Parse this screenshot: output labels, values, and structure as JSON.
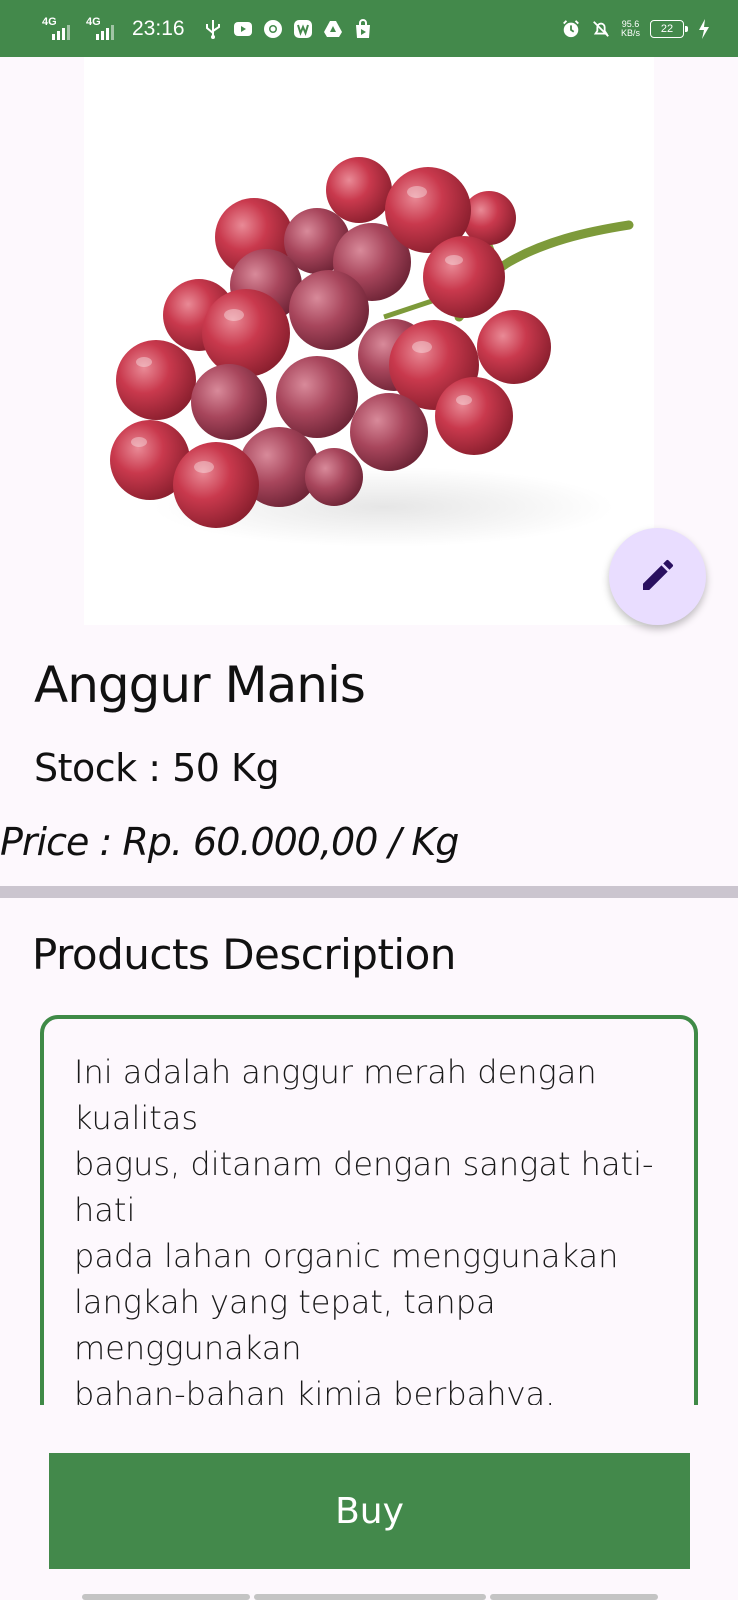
{
  "status_bar": {
    "sig1": "4G",
    "sig2": "4G",
    "time": "23:16",
    "net_speed_value": "95.6",
    "net_speed_unit": "KB/s",
    "battery": "22"
  },
  "product": {
    "name": "Anggur Manis",
    "stock": "Stock : 50 Kg",
    "price": "Price : Rp. 60.000,00 / Kg"
  },
  "description": {
    "heading": "Products Description",
    "text": "Ini adalah anggur merah dengan kualitas\nbagus, ditanam dengan sangat hati-hati\npada lahan organic menggunakan\nlangkah yang tepat, tanpa menggunakan\nbahan-bahan kimia berbahya.\n\nMemiliki rasa yang manis, dan sangat\nlembut di lidah, dapat juga di makan oleh"
  },
  "actions": {
    "buy_label": "Buy",
    "edit_icon": "pencil-icon"
  },
  "colors": {
    "primary": "#43894b",
    "fab_bg": "#e9ddff",
    "fab_icon": "#2a1060",
    "background": "#fdf8fd"
  }
}
